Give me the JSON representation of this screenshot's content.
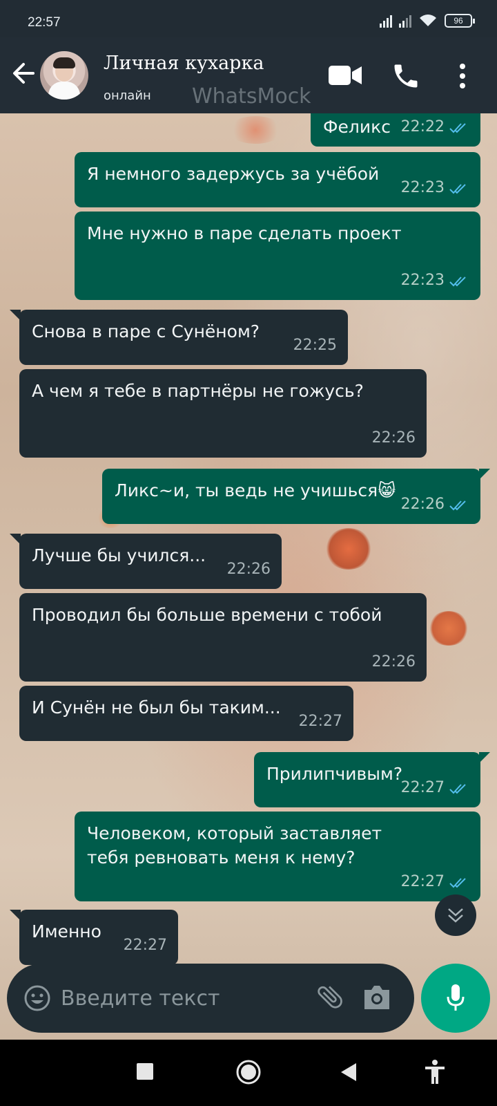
{
  "status_bar": {
    "time": "22:57",
    "battery": "96"
  },
  "header": {
    "contact_name": "Личная кухарка",
    "contact_status": "онлайн",
    "watermark": "WhatsMock"
  },
  "messages": [
    {
      "dir": "out",
      "text": "Феликс",
      "time": "22:22"
    },
    {
      "dir": "out",
      "text": "Я немного задержусь за учёбой",
      "time": "22:23"
    },
    {
      "dir": "out",
      "text": "Мне нужно в паре сделать проект",
      "time": "22:23"
    },
    {
      "dir": "in",
      "text": "Снова в паре с Сунёном?",
      "time": "22:25"
    },
    {
      "dir": "in",
      "text": "А чем я тебе в партнёры не гожусь?",
      "time": "22:26"
    },
    {
      "dir": "out",
      "text": "Ликс~и, ты ведь не учишься😸",
      "time": "22:26"
    },
    {
      "dir": "in",
      "text": "Лучше бы учился...",
      "time": "22:26"
    },
    {
      "dir": "in",
      "text": "Проводил бы больше времени с тобой",
      "time": "22:26"
    },
    {
      "dir": "in",
      "text": "И Сунён не был бы таким...",
      "time": "22:27"
    },
    {
      "dir": "out",
      "text": "Прилипчивым?",
      "time": "22:27"
    },
    {
      "dir": "out",
      "text": "Человеком, который заставляет тебя ревновать меня к нему?",
      "time": "22:27"
    },
    {
      "dir": "in",
      "text": "Именно",
      "time": "22:27"
    }
  ],
  "input": {
    "placeholder": "Введите текст",
    "value": ""
  },
  "colors": {
    "outgoing_bubble": "#005c4b",
    "incoming_bubble": "#202c33",
    "header": "#232d36",
    "mic_button": "#00a884",
    "read_ticks": "#53bdeb"
  }
}
